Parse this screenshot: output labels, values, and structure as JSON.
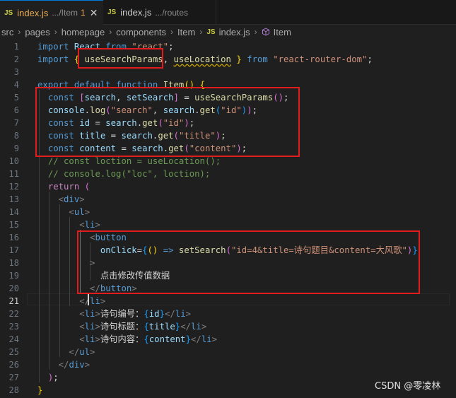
{
  "tabs": [
    {
      "badge": "JS",
      "name": "index.js",
      "path": ".../Item",
      "modified": "1",
      "close": "✕",
      "active": true
    },
    {
      "badge": "JS",
      "name": "index.js",
      "path": ".../routes",
      "active": false
    }
  ],
  "breadcrumb": {
    "segments": [
      "src",
      "pages",
      "homepage",
      "components",
      "Item"
    ],
    "file_badge": "JS",
    "file": "index.js",
    "symbol": "Item",
    "separator": "›"
  },
  "editor": {
    "current_line": 21,
    "line_numbers": [
      "1",
      "2",
      "3",
      "4",
      "5",
      "6",
      "7",
      "8",
      "9",
      "10",
      "11",
      "12",
      "13",
      "14",
      "15",
      "16",
      "17",
      "18",
      "19",
      "20",
      "21",
      "22",
      "23",
      "24",
      "25",
      "26",
      "27",
      "28"
    ],
    "lines": [
      [
        [
          "kw",
          "import "
        ],
        [
          "id",
          "React "
        ],
        [
          "kw",
          "from "
        ],
        [
          "str",
          "\"react\""
        ],
        [
          "txt",
          ";"
        ]
      ],
      [
        [
          "kw",
          "import "
        ],
        [
          "br1",
          "{ "
        ],
        [
          "fn",
          "useSearchParams"
        ],
        [
          "txt",
          ", "
        ],
        [
          "fnsq",
          "useLocation"
        ],
        [
          "txt",
          " "
        ],
        [
          "br1",
          "}"
        ],
        [
          "kw",
          " from "
        ],
        [
          "str",
          "\"react-router-dom\""
        ],
        [
          "txt",
          ";"
        ]
      ],
      [],
      [
        [
          "kw",
          "export "
        ],
        [
          "kw",
          "default "
        ],
        [
          "kw",
          "function "
        ],
        [
          "fn",
          "Item"
        ],
        [
          "br1",
          "()"
        ],
        [
          "txt",
          " "
        ],
        [
          "br1",
          "{"
        ]
      ],
      [
        [
          "txt",
          "  "
        ],
        [
          "kw",
          "const "
        ],
        [
          "br2",
          "["
        ],
        [
          "id",
          "search"
        ],
        [
          "txt",
          ", "
        ],
        [
          "id",
          "setSearch"
        ],
        [
          "br2",
          "]"
        ],
        [
          "txt",
          " = "
        ],
        [
          "fn",
          "useSearchParams"
        ],
        [
          "br2",
          "()"
        ],
        [
          "txt",
          ";"
        ]
      ],
      [
        [
          "txt",
          "  "
        ],
        [
          "id",
          "console"
        ],
        [
          "txt",
          "."
        ],
        [
          "fn",
          "log"
        ],
        [
          "br2",
          "("
        ],
        [
          "str",
          "\"search\""
        ],
        [
          "txt",
          ", "
        ],
        [
          "id",
          "search"
        ],
        [
          "txt",
          "."
        ],
        [
          "fn",
          "get"
        ],
        [
          "br3",
          "("
        ],
        [
          "str",
          "\"id\""
        ],
        [
          "br3",
          ")"
        ],
        [
          "br2",
          ")"
        ],
        [
          "txt",
          ";"
        ]
      ],
      [
        [
          "txt",
          "  "
        ],
        [
          "kw",
          "const "
        ],
        [
          "id",
          "id"
        ],
        [
          "txt",
          " = "
        ],
        [
          "id",
          "search"
        ],
        [
          "txt",
          "."
        ],
        [
          "fn",
          "get"
        ],
        [
          "br2",
          "("
        ],
        [
          "str",
          "\"id\""
        ],
        [
          "br2",
          ")"
        ],
        [
          "txt",
          ";"
        ]
      ],
      [
        [
          "txt",
          "  "
        ],
        [
          "kw",
          "const "
        ],
        [
          "id",
          "title"
        ],
        [
          "txt",
          " = "
        ],
        [
          "id",
          "search"
        ],
        [
          "txt",
          "."
        ],
        [
          "fn",
          "get"
        ],
        [
          "br2",
          "("
        ],
        [
          "str",
          "\"title\""
        ],
        [
          "br2",
          ")"
        ],
        [
          "txt",
          ";"
        ]
      ],
      [
        [
          "txt",
          "  "
        ],
        [
          "kw",
          "const "
        ],
        [
          "id",
          "content"
        ],
        [
          "txt",
          " = "
        ],
        [
          "id",
          "search"
        ],
        [
          "txt",
          "."
        ],
        [
          "fn",
          "get"
        ],
        [
          "br2",
          "("
        ],
        [
          "str",
          "\"content\""
        ],
        [
          "br2",
          ")"
        ],
        [
          "txt",
          ";"
        ]
      ],
      [
        [
          "txt",
          "  "
        ],
        [
          "cmt",
          "// const loction = useLocation();"
        ]
      ],
      [
        [
          "txt",
          "  "
        ],
        [
          "cmt",
          "// console.log(\"loc\", loction);"
        ]
      ],
      [
        [
          "txt",
          "  "
        ],
        [
          "ctl",
          "return "
        ],
        [
          "br2",
          "("
        ]
      ],
      [
        [
          "txt",
          "    "
        ],
        [
          "ang",
          "<"
        ],
        [
          "tag",
          "div"
        ],
        [
          "ang",
          ">"
        ]
      ],
      [
        [
          "txt",
          "      "
        ],
        [
          "ang",
          "<"
        ],
        [
          "tag",
          "ul"
        ],
        [
          "ang",
          ">"
        ]
      ],
      [
        [
          "txt",
          "        "
        ],
        [
          "ang",
          "<"
        ],
        [
          "tag",
          "li"
        ],
        [
          "ang",
          ">"
        ]
      ],
      [
        [
          "txt",
          "          "
        ],
        [
          "ang",
          "<"
        ],
        [
          "tag",
          "button"
        ]
      ],
      [
        [
          "txt",
          "            "
        ],
        [
          "attr",
          "onClick"
        ],
        [
          "txt",
          "="
        ],
        [
          "br3",
          "{"
        ],
        [
          "br1",
          "()"
        ],
        [
          "txt",
          " "
        ],
        [
          "kw",
          "=>"
        ],
        [
          "txt",
          " "
        ],
        [
          "fn",
          "setSearch"
        ],
        [
          "br2",
          "("
        ],
        [
          "str",
          "\"id=4&title=诗句题目&content=大风歌\""
        ],
        [
          "br2",
          ")"
        ],
        [
          "br3",
          "}"
        ]
      ],
      [
        [
          "txt",
          "          "
        ],
        [
          "ang",
          ">"
        ]
      ],
      [
        [
          "txt",
          "            "
        ],
        [
          "txt",
          "点击修改传值数据"
        ]
      ],
      [
        [
          "txt",
          "          "
        ],
        [
          "ang",
          "</"
        ],
        [
          "tag",
          "button"
        ],
        [
          "ang",
          ">"
        ]
      ],
      [
        [
          "txt",
          "        "
        ],
        [
          "ang",
          "</"
        ],
        [
          "tag",
          "li"
        ],
        [
          "ang",
          ">"
        ]
      ],
      [
        [
          "txt",
          "        "
        ],
        [
          "ang",
          "<"
        ],
        [
          "tag",
          "li"
        ],
        [
          "ang",
          ">"
        ],
        [
          "txt",
          "诗句编号："
        ],
        [
          "br3",
          "{"
        ],
        [
          "id",
          "id"
        ],
        [
          "br3",
          "}"
        ],
        [
          "ang",
          "</"
        ],
        [
          "tag",
          "li"
        ],
        [
          "ang",
          ">"
        ]
      ],
      [
        [
          "txt",
          "        "
        ],
        [
          "ang",
          "<"
        ],
        [
          "tag",
          "li"
        ],
        [
          "ang",
          ">"
        ],
        [
          "txt",
          "诗句标题："
        ],
        [
          "br3",
          "{"
        ],
        [
          "id",
          "title"
        ],
        [
          "br3",
          "}"
        ],
        [
          "ang",
          "</"
        ],
        [
          "tag",
          "li"
        ],
        [
          "ang",
          ">"
        ]
      ],
      [
        [
          "txt",
          "        "
        ],
        [
          "ang",
          "<"
        ],
        [
          "tag",
          "li"
        ],
        [
          "ang",
          ">"
        ],
        [
          "txt",
          "诗句内容："
        ],
        [
          "br3",
          "{"
        ],
        [
          "id",
          "content"
        ],
        [
          "br3",
          "}"
        ],
        [
          "ang",
          "</"
        ],
        [
          "tag",
          "li"
        ],
        [
          "ang",
          ">"
        ]
      ],
      [
        [
          "txt",
          "      "
        ],
        [
          "ang",
          "</"
        ],
        [
          "tag",
          "ul"
        ],
        [
          "ang",
          ">"
        ]
      ],
      [
        [
          "txt",
          "    "
        ],
        [
          "ang",
          "</"
        ],
        [
          "tag",
          "div"
        ],
        [
          "ang",
          ">"
        ]
      ],
      [
        [
          "txt",
          "  "
        ],
        [
          "br2",
          ")"
        ],
        [
          "txt",
          ";"
        ]
      ],
      [
        [
          "br1",
          "}"
        ]
      ]
    ]
  },
  "watermark": "CSDN @零凌林",
  "colors": {
    "highlight_box": "#e11c1c",
    "active_tab_border": "#0078d4"
  },
  "icons": {
    "breadcrumb_symbol": "cube-icon",
    "tab_close": "close-icon"
  }
}
